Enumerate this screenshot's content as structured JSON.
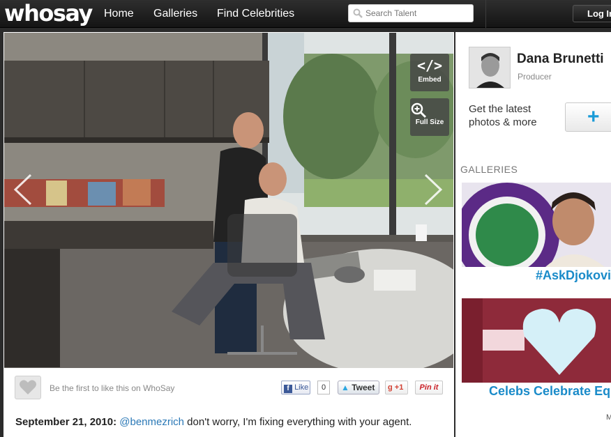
{
  "header": {
    "logo": "whosay",
    "nav": [
      "Home",
      "Galleries",
      "Find Celebrities"
    ],
    "search_placeholder": "Search Talent",
    "login_label": "Log In"
  },
  "photo": {
    "embed_label": "Embed",
    "embed_glyph": "</>",
    "fullsize_label": "Full Size",
    "prev_glyph": "‹",
    "next_glyph": "›"
  },
  "social": {
    "like_prompt": "Be the first to like this on WhoSay",
    "fb_like": "Like",
    "fb_count": "0",
    "tweet": "Tweet",
    "gplus": "+1",
    "pin": "Pin it"
  },
  "caption": {
    "date": "September 21, 2010:",
    "mention": "@benmezrich",
    "text": " don't worry, I'm fixing everything with your agent."
  },
  "profile": {
    "name": "Dana Brunetti",
    "role": "Producer",
    "promo": "Get the latest photos & more"
  },
  "galleries": {
    "header": "GALLERIES",
    "items": [
      {
        "title": "#AskDjokovic"
      },
      {
        "title": "Celebs Celebrate Equality"
      }
    ],
    "more_fragment": "M"
  },
  "colors": {
    "accent": "#1a8bc9",
    "topbar": "#1e1e1e",
    "page_bg": "#2b2b2b"
  }
}
